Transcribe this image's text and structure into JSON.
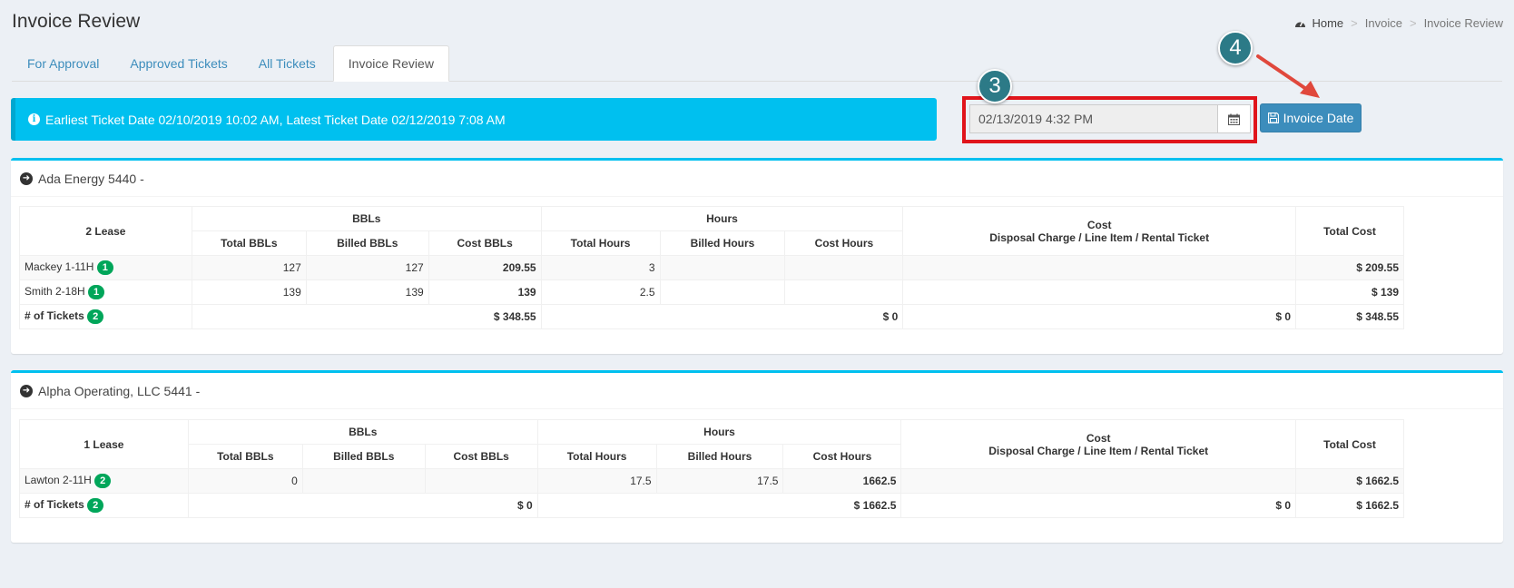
{
  "page": {
    "title": "Invoice Review"
  },
  "breadcrumb": {
    "home": "Home",
    "items": [
      "Invoice",
      "Invoice Review"
    ],
    "separator": ">"
  },
  "tabs": [
    "For Approval",
    "Approved Tickets",
    "All Tickets",
    "Invoice Review"
  ],
  "info": {
    "text": "Earliest Ticket Date 02/10/2019 10:02 AM, Latest Ticket Date 02/12/2019 7:08 AM"
  },
  "invoice": {
    "date_value": "02/13/2019 4:32 PM",
    "button_label": "Invoice Date"
  },
  "steps": {
    "date_step": "3",
    "button_step": "4"
  },
  "table_headers": {
    "bbls": "BBLs",
    "hours": "Hours",
    "cost_line1": "Cost",
    "cost_line2": "Disposal Charge / Line Item / Rental Ticket",
    "total_cost": "Total Cost",
    "total_bbls": "Total BBLs",
    "billed_bbls": "Billed BBLs",
    "cost_bbls": "Cost BBLs",
    "total_hours": "Total Hours",
    "billed_hours": "Billed Hours",
    "cost_hours": "Cost Hours"
  },
  "companies": [
    {
      "title": "Ada Energy 5440 -",
      "lease_count": "2 Lease",
      "rows": [
        {
          "lease": "Mackey 1-11H",
          "tickets": "1",
          "total_bbls": "127",
          "billed_bbls": "127",
          "cost_bbls": "209.55",
          "total_hours": "3",
          "billed_hours": "",
          "cost_hours": "",
          "cost": "",
          "total_cost": "$ 209.55"
        },
        {
          "lease": "Smith 2-18H",
          "tickets": "1",
          "total_bbls": "139",
          "billed_bbls": "139",
          "cost_bbls": "139",
          "total_hours": "2.5",
          "billed_hours": "",
          "cost_hours": "",
          "cost": "",
          "total_cost": "$ 139"
        }
      ],
      "totals": {
        "label": "# of Tickets",
        "tickets": "2",
        "bbls_cost": "$ 348.55",
        "hours_cost": "$ 0",
        "cost": "$ 0",
        "total_cost": "$ 348.55"
      }
    },
    {
      "title": "Alpha Operating, LLC 5441 -",
      "lease_count": "1 Lease",
      "rows": [
        {
          "lease": "Lawton 2-11H",
          "tickets": "2",
          "total_bbls": "0",
          "billed_bbls": "",
          "cost_bbls": "",
          "total_hours": "17.5",
          "billed_hours": "17.5",
          "cost_hours": "1662.5",
          "cost": "",
          "total_cost": "$ 1662.5"
        }
      ],
      "totals": {
        "label": "# of Tickets",
        "tickets": "2",
        "bbls_cost": "$ 0",
        "hours_cost": "$ 1662.5",
        "cost": "$ 0",
        "total_cost": "$ 1662.5"
      }
    }
  ],
  "colors": {
    "accent": "#3c8dbc",
    "info": "#00c0ef",
    "badge": "#00a65a",
    "highlight": "#e0141b",
    "step": "#2c7a87"
  }
}
